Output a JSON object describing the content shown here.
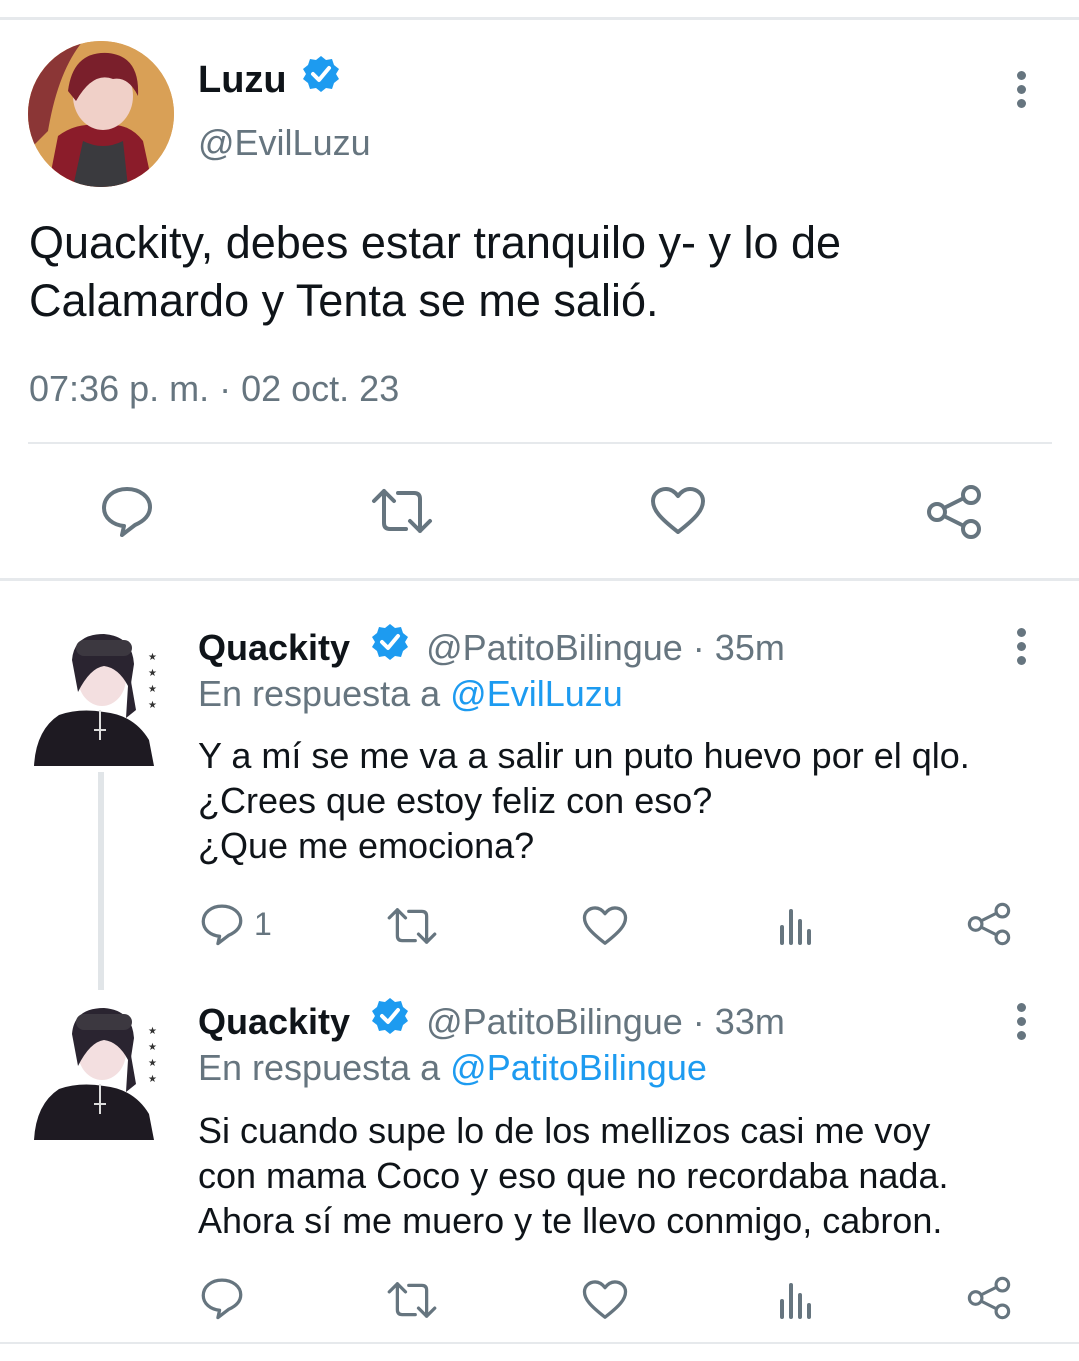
{
  "colors": {
    "accent": "#1d9bf0",
    "muted": "#66757f",
    "divider": "#e6e9ec"
  },
  "main_tweet": {
    "name": "Luzu",
    "handle": "@EvilLuzu",
    "text_line1": "Quackity, debes estar tranquilo y- y lo de",
    "text_line2": "Calamardo y Tenta se me salió.",
    "timestamp": "07:36 p. m. · 02 oct. 23",
    "icons": [
      "reply-icon",
      "retweet-icon",
      "like-icon",
      "share-icon"
    ]
  },
  "replies": [
    {
      "name": "Quackity",
      "handle_time": "@PatitoBilingue · 35m",
      "reply_prefix": "En respuesta a",
      "reply_to": "@EvilLuzu",
      "line1": "Y a mí se me va a salir un puto huevo por el qlo.",
      "line2": "¿Crees que estoy feliz con eso?",
      "line3": "¿Que me emociona?",
      "reply_count": "1"
    },
    {
      "name": "Quackity",
      "handle_time": "@PatitoBilingue · 33m",
      "reply_prefix": "En respuesta a",
      "reply_to": "@PatitoBilingue",
      "line1": "Si cuando supe lo de los mellizos casi me voy",
      "line2": "con mama Coco y eso que no recordaba nada.",
      "line3": "Ahora sí me muero y te llevo conmigo, cabron.",
      "reply_count": ""
    }
  ]
}
